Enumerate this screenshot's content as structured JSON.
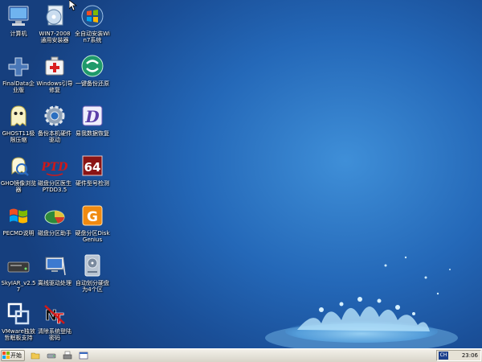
{
  "desktop": {
    "icons": [
      {
        "label": "计算机",
        "icon": "computer-icon"
      },
      {
        "label": "WIN7-2008通用安装器",
        "icon": "installer-disc-icon"
      },
      {
        "label": "全自动安装Win7系统",
        "icon": "windows-orb-icon"
      },
      {
        "label": "FinalData企业版",
        "icon": "finaldata-icon"
      },
      {
        "label": "Windows引导修复",
        "icon": "first-aid-box-icon"
      },
      {
        "label": "一键备份还原",
        "icon": "backup-restore-icon"
      },
      {
        "label": "GHOST11极限压缩",
        "icon": "ghost-icon"
      },
      {
        "label": "备份本机硬件驱动",
        "icon": "gear-icon"
      },
      {
        "label": "易我数据恢复",
        "icon": "data-recovery-icon"
      },
      {
        "label": "GHO镜像浏览器",
        "icon": "gho-browser-icon"
      },
      {
        "label": "磁盘分区医生PTDD3.5",
        "icon": "ptdd-icon"
      },
      {
        "label": "硬件型号检测",
        "icon": "hw-64-icon"
      },
      {
        "label": "PECMD说明",
        "icon": "windows-flag-icon"
      },
      {
        "label": "磁盘分区助手",
        "icon": "partition-assistant-icon"
      },
      {
        "label": "硬盘分区DiskGenius",
        "icon": "diskgenius-icon"
      },
      {
        "label": "SkyIAR_v2.57",
        "icon": "skyiar-icon"
      },
      {
        "label": "离线驱动处理",
        "icon": "offline-driver-icon"
      },
      {
        "label": "自动划分硬盘为4个区",
        "icon": "auto-partition-icon"
      },
      {
        "label": "VMware独放哲眠板支持",
        "icon": "vmware-icon"
      },
      {
        "label": "清除系统登陆密码",
        "icon": "clear-password-icon"
      }
    ]
  },
  "taskbar": {
    "start_label": "开始",
    "quick_launch": [
      "folder-icon",
      "drive-icon",
      "printer-icon",
      "window-icon"
    ],
    "ime": "CH",
    "clock": "23:06"
  },
  "colors": {
    "desktop_bg": "#2468b8",
    "taskbar_bg": "#e6e2d6",
    "ime_badge": "#1c3f8c"
  }
}
